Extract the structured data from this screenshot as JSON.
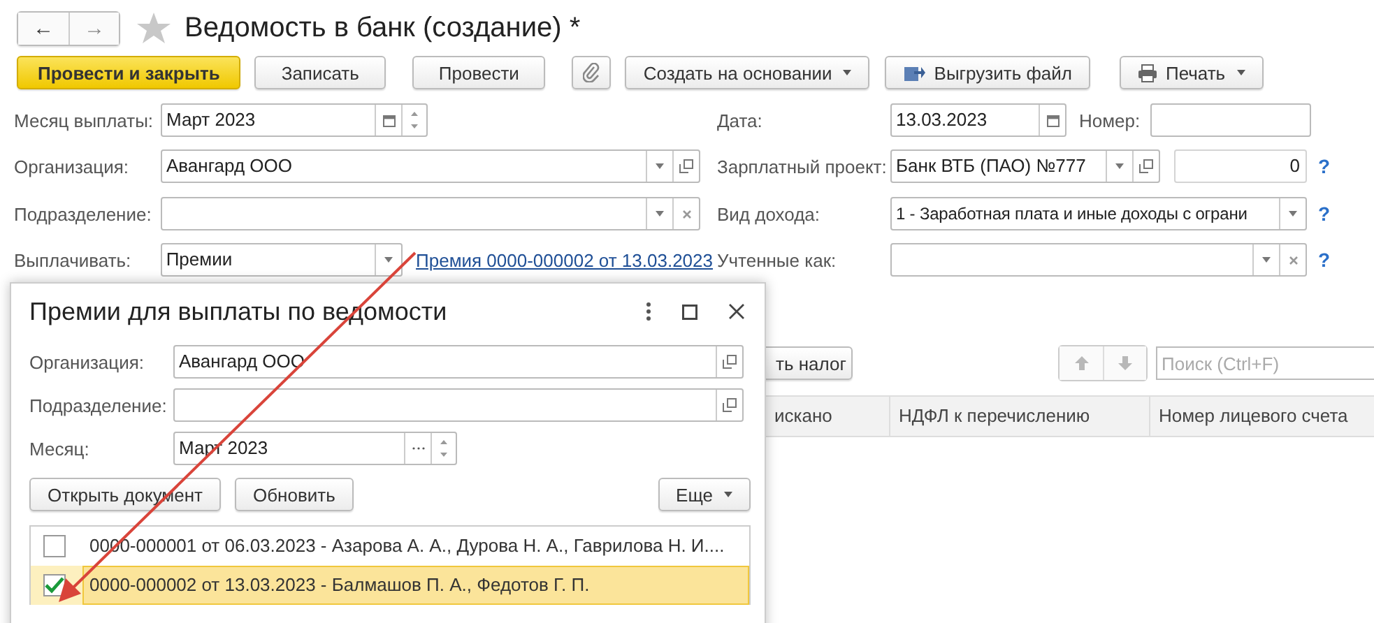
{
  "header": {
    "back": "←",
    "forward": "→",
    "title": "Ведомость в банк (создание) *"
  },
  "toolbar": [
    {
      "label": "Провести и закрыть",
      "kind": "primary"
    },
    {
      "label": "Записать",
      "kind": "plain"
    },
    {
      "label": "Провести",
      "kind": "plain"
    },
    {
      "kind": "attach"
    },
    {
      "label": "Создать на основании",
      "kind": "dropdown"
    },
    {
      "label": "Выгрузить файл",
      "kind": "upload"
    },
    {
      "label": "Печать",
      "kind": "print"
    }
  ],
  "left_fields": [
    {
      "label": "Месяц выплаты:",
      "value": "Март 2023",
      "kind": "period"
    },
    {
      "label": "Организация:",
      "value": "Авангард ООО",
      "kind": "reference"
    },
    {
      "label": "Подразделение:",
      "kind": "clearable"
    },
    {
      "label": "Выплачивать:",
      "value": "Премии",
      "kind": "choice",
      "link": "Премия 0000-000002 от 13.03.2023"
    }
  ],
  "date": {
    "label": "Дата:",
    "value": "13.03.2023",
    "kind": "date"
  },
  "number": {
    "label": "Номер:"
  },
  "salary_project": {
    "label": "Зарплатный проект:",
    "value": "Банк ВТБ (ПАО) №777",
    "kind": "reference",
    "count": "0",
    "help": "?"
  },
  "income_kind": {
    "label": "Вид дохода:",
    "value": "1 - Заработная плата и иные доходы с ограни",
    "kind": "choice",
    "help": "?"
  },
  "accounted_as": {
    "label": "Учтенные как:",
    "kind": "clearable",
    "help": "?"
  },
  "table_toolbar": {
    "tax_button": "ть налог",
    "search": {
      "placeholder": "Поиск (Ctrl+F)"
    }
  },
  "table": {
    "columns": [
      "искано",
      "НДФЛ к перечислению",
      "Номер лицевого счета"
    ]
  },
  "popup": {
    "title": "Премии для выплаты по ведомости",
    "fields": [
      {
        "label": "Организация:",
        "value": "Авангард ООО",
        "kind": "link"
      },
      {
        "label": "Подразделение:",
        "kind": "link"
      },
      {
        "label": "Месяц:",
        "value": "Март 2023",
        "kind": "month"
      }
    ],
    "buttons": [
      "Открыть документ",
      "Обновить"
    ],
    "more": "Еще",
    "items": [
      {
        "text": "0000-000001 от 06.03.2023 - Азарова А. А., Дурова Н. А., Гаврилова Н. И....",
        "checked": false,
        "selected": false
      },
      {
        "text": "0000-000002 от 13.03.2023 - Балмашов П. А., Федотов Г. П.",
        "checked": true,
        "selected": true
      }
    ]
  }
}
